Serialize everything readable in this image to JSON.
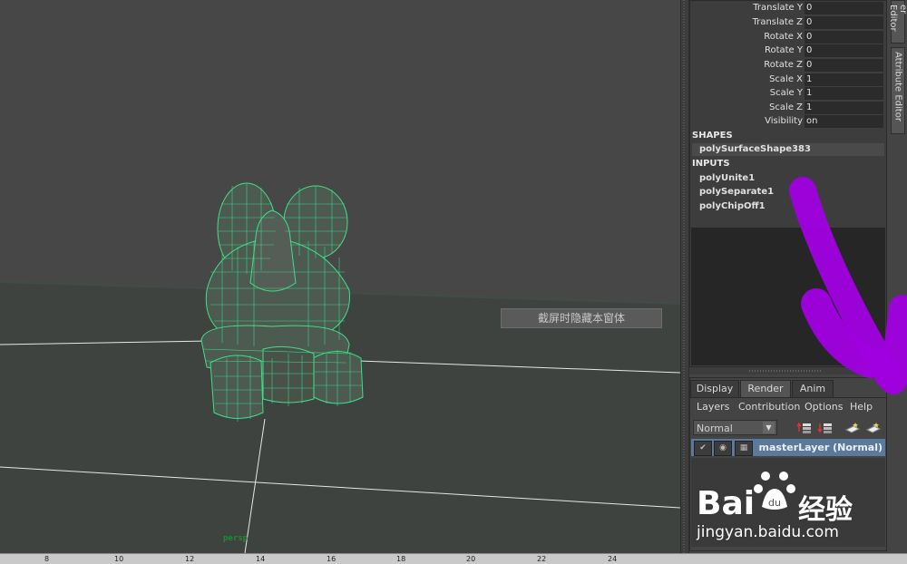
{
  "viewport": {
    "hud_text": "截屏时隐藏本窗体",
    "camera_label": "persp"
  },
  "time_slider": {
    "ticks": [
      "8",
      "10",
      "12",
      "14",
      "16",
      "18",
      "20",
      "22",
      "24"
    ]
  },
  "channel_box": {
    "attributes": [
      {
        "name": "Translate Y",
        "value": "0"
      },
      {
        "name": "Translate Z",
        "value": "0"
      },
      {
        "name": "Rotate X",
        "value": "0"
      },
      {
        "name": "Rotate Y",
        "value": "0"
      },
      {
        "name": "Rotate Z",
        "value": "0"
      },
      {
        "name": "Scale X",
        "value": "1"
      },
      {
        "name": "Scale Y",
        "value": "1"
      },
      {
        "name": "Scale Z",
        "value": "1"
      },
      {
        "name": "Visibility",
        "value": "on"
      }
    ],
    "shapes_heading": "SHAPES",
    "shape_node": "polySurfaceShape383",
    "inputs_heading": "INPUTS",
    "input_nodes": [
      "polyUnite1",
      "polySeparate1",
      "polyChipOff1"
    ]
  },
  "side_tabs": {
    "tab1": "er Editor",
    "tab2": "Attribute Editor"
  },
  "layer_editor": {
    "tabs": [
      "Display",
      "Render",
      "Anim"
    ],
    "active_tab": "Render",
    "menus": [
      "Layers",
      "Contribution",
      "Options",
      "Help"
    ],
    "blend_mode": "Normal",
    "layer_name": "masterLayer (Normal)"
  },
  "watermark": {
    "brand": "Bai",
    "brand_cn": "经验",
    "url": "jingyan.baidu.com"
  },
  "colors": {
    "wireframe": "#3fe08a",
    "annotation_stroke": "#a000e0",
    "layer_highlight": "#5b7a9b"
  }
}
